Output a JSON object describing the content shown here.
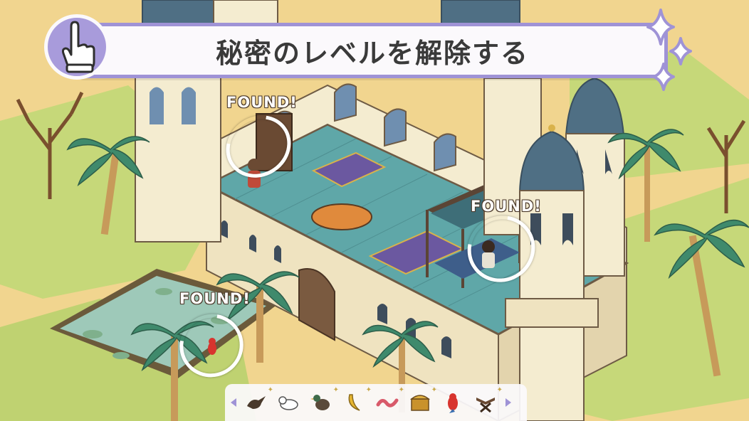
{
  "banner": {
    "title": "秘密のレベルを解除する"
  },
  "found_markers": [
    {
      "label": "FOUND!",
      "target": "girl-reading-book"
    },
    {
      "label": "FOUND!",
      "target": "person-by-bed"
    },
    {
      "label": "FOUND!",
      "target": "red-parrot"
    }
  ],
  "item_tray": {
    "items": [
      {
        "icon": "bird-silhouette-icon"
      },
      {
        "icon": "white-cat-icon"
      },
      {
        "icon": "duck-icon"
      },
      {
        "icon": "banana-icon"
      },
      {
        "icon": "worm-icon"
      },
      {
        "icon": "treasure-chest-icon"
      },
      {
        "icon": "parrot-icon"
      },
      {
        "icon": "bookstand-icon"
      }
    ]
  },
  "colors": {
    "banner_border": "#9f93d6",
    "banner_bg": "#fbf9fc",
    "sand": "#f1d58f",
    "grass": "#c6d879",
    "palace_wall": "#f4ecd0",
    "dome": "#4f6f84",
    "floor": "#5fa7a8",
    "water": "#9ec9b9"
  }
}
